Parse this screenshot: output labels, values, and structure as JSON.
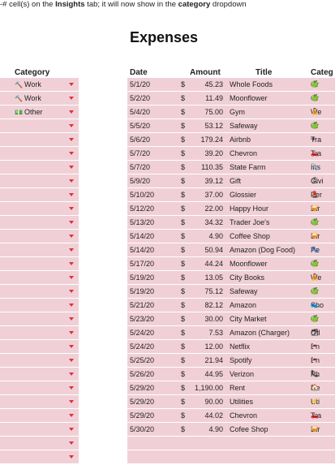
{
  "note": {
    "prefix": "-# cell(s) on the ",
    "tab": "Insights",
    "middle": " tab; it will now show in the ",
    "field": "category",
    "suffix": " dropdown"
  },
  "title": "Expenses",
  "category_panel": {
    "header": "Category",
    "items": [
      {
        "icon": "tool-icon",
        "glyph": "🔨",
        "label": "Work"
      },
      {
        "icon": "tool-icon",
        "glyph": "🔨",
        "label": "Work"
      },
      {
        "icon": "money-icon",
        "glyph": "💵",
        "label": "Other"
      },
      {
        "label": ""
      },
      {
        "label": ""
      },
      {
        "label": ""
      },
      {
        "label": ""
      },
      {
        "label": ""
      },
      {
        "label": ""
      },
      {
        "label": ""
      },
      {
        "label": ""
      },
      {
        "label": ""
      },
      {
        "label": ""
      },
      {
        "label": ""
      },
      {
        "label": ""
      },
      {
        "label": ""
      },
      {
        "label": ""
      },
      {
        "label": ""
      },
      {
        "label": ""
      },
      {
        "label": ""
      },
      {
        "label": ""
      },
      {
        "label": ""
      },
      {
        "label": ""
      },
      {
        "label": ""
      },
      {
        "label": ""
      },
      {
        "label": ""
      },
      {
        "label": ""
      },
      {
        "label": ""
      }
    ]
  },
  "table": {
    "columns": [
      "Date",
      "Amount",
      "Title",
      "Categ"
    ],
    "currency": "$",
    "rows": [
      {
        "date": "5/1/20",
        "amount": "45.23",
        "title": "Whole Foods",
        "cat_icon": "apple-icon",
        "cat_glyph": "🍏",
        "category": "Gr"
      },
      {
        "date": "5/2/20",
        "amount": "11.49",
        "title": "Moonflower",
        "cat_icon": "apple-icon",
        "cat_glyph": "🍏",
        "category": "Gr"
      },
      {
        "date": "5/4/20",
        "amount": "75.00",
        "title": "Gym",
        "cat_icon": "yoga-icon",
        "cat_glyph": "🧘",
        "category": "We"
      },
      {
        "date": "5/5/20",
        "amount": "53.12",
        "title": "Safeway",
        "cat_icon": "apple-icon",
        "cat_glyph": "🍏",
        "category": "Gr"
      },
      {
        "date": "5/6/20",
        "amount": "179.24",
        "title": "Airbnb",
        "cat_icon": "plane-icon",
        "cat_glyph": "✈",
        "category": "Tra"
      },
      {
        "date": "5/7/20",
        "amount": "39.20",
        "title": "Chevron",
        "cat_icon": "car-icon",
        "cat_glyph": "🚗",
        "category": "Tra"
      },
      {
        "date": "5/7/20",
        "amount": "110.35",
        "title": "State Farm",
        "cat_icon": "paperclip-icon",
        "cat_glyph": "📎",
        "category": "Ins"
      },
      {
        "date": "5/9/20",
        "amount": "39.12",
        "title": "Gift",
        "cat_icon": "ribbon-icon",
        "cat_glyph": "🎗",
        "category": "Givi"
      },
      {
        "date": "5/10/20",
        "amount": "37.00",
        "title": "Glossier",
        "cat_icon": "lipstick-icon",
        "cat_glyph": "💄",
        "category": "Per"
      },
      {
        "date": "5/12/20",
        "amount": "22.00",
        "title": "Happy Hour",
        "cat_icon": "food-icon",
        "cat_glyph": "🥪",
        "category": "Dir"
      },
      {
        "date": "5/13/20",
        "amount": "34.32",
        "title": "Trader Joe's",
        "cat_icon": "apple-icon",
        "cat_glyph": "🍏",
        "category": "Gr"
      },
      {
        "date": "5/14/20",
        "amount": "4.90",
        "title": "Coffee Shop",
        "cat_icon": "food-icon",
        "cat_glyph": "🥪",
        "category": "Dir"
      },
      {
        "date": "5/14/20",
        "amount": "50.94",
        "title": "Amazon (Dog Food)",
        "cat_icon": "paw-icon",
        "cat_glyph": "🐾",
        "category": "Pe"
      },
      {
        "date": "5/17/20",
        "amount": "44.24",
        "title": "Moonflower",
        "cat_icon": "apple-icon",
        "cat_glyph": "🍏",
        "category": "Gr"
      },
      {
        "date": "5/19/20",
        "amount": "13.05",
        "title": "City Books",
        "cat_icon": "yoga-icon",
        "cat_glyph": "🧘",
        "category": "We"
      },
      {
        "date": "5/19/20",
        "amount": "75.12",
        "title": "Safeway",
        "cat_icon": "apple-icon",
        "cat_glyph": "🍏",
        "category": "Gr"
      },
      {
        "date": "5/21/20",
        "amount": "82.12",
        "title": "Amazon",
        "cat_icon": "shoe-icon",
        "cat_glyph": "👟",
        "category": "Sho"
      },
      {
        "date": "5/23/20",
        "amount": "30.00",
        "title": "City Market",
        "cat_icon": "apple-icon",
        "cat_glyph": "🍏",
        "category": "Gr"
      },
      {
        "date": "5/24/20",
        "amount": "7.53",
        "title": "Amazon (Charger)",
        "cat_icon": "box-icon",
        "cat_glyph": "🗃",
        "category": "Otl"
      },
      {
        "date": "5/24/20",
        "amount": "12.00",
        "title": "Netflix",
        "cat_icon": "drinks-icon",
        "cat_glyph": "🍷",
        "category": "En"
      },
      {
        "date": "5/25/20",
        "amount": "21.94",
        "title": "Spotify",
        "cat_icon": "drinks-icon",
        "cat_glyph": "🍷",
        "category": "En"
      },
      {
        "date": "5/26/20",
        "amount": "44.95",
        "title": "Verizon",
        "cat_icon": "phone-icon",
        "cat_glyph": "📞",
        "category": "Ph"
      },
      {
        "date": "5/29/20",
        "amount": "1,190.00",
        "title": "Rent",
        "cat_icon": "house-icon",
        "cat_glyph": "🏠",
        "category": "Re"
      },
      {
        "date": "5/29/20",
        "amount": "90.00",
        "title": "Utilities",
        "cat_icon": "bolt-icon",
        "cat_glyph": "⚡",
        "category": "Uti"
      },
      {
        "date": "5/29/20",
        "amount": "44.02",
        "title": "Chevron",
        "cat_icon": "car-icon",
        "cat_glyph": "🚗",
        "category": "Tra"
      },
      {
        "date": "5/30/20",
        "amount": "4.90",
        "title": "Cofee Shop",
        "cat_icon": "food-icon",
        "cat_glyph": "🥪",
        "category": "Dir"
      }
    ],
    "empty_rows": 2
  },
  "colors": {
    "row_bg": "#f0d0d6",
    "dropdown_arrow": "#e0303a"
  }
}
